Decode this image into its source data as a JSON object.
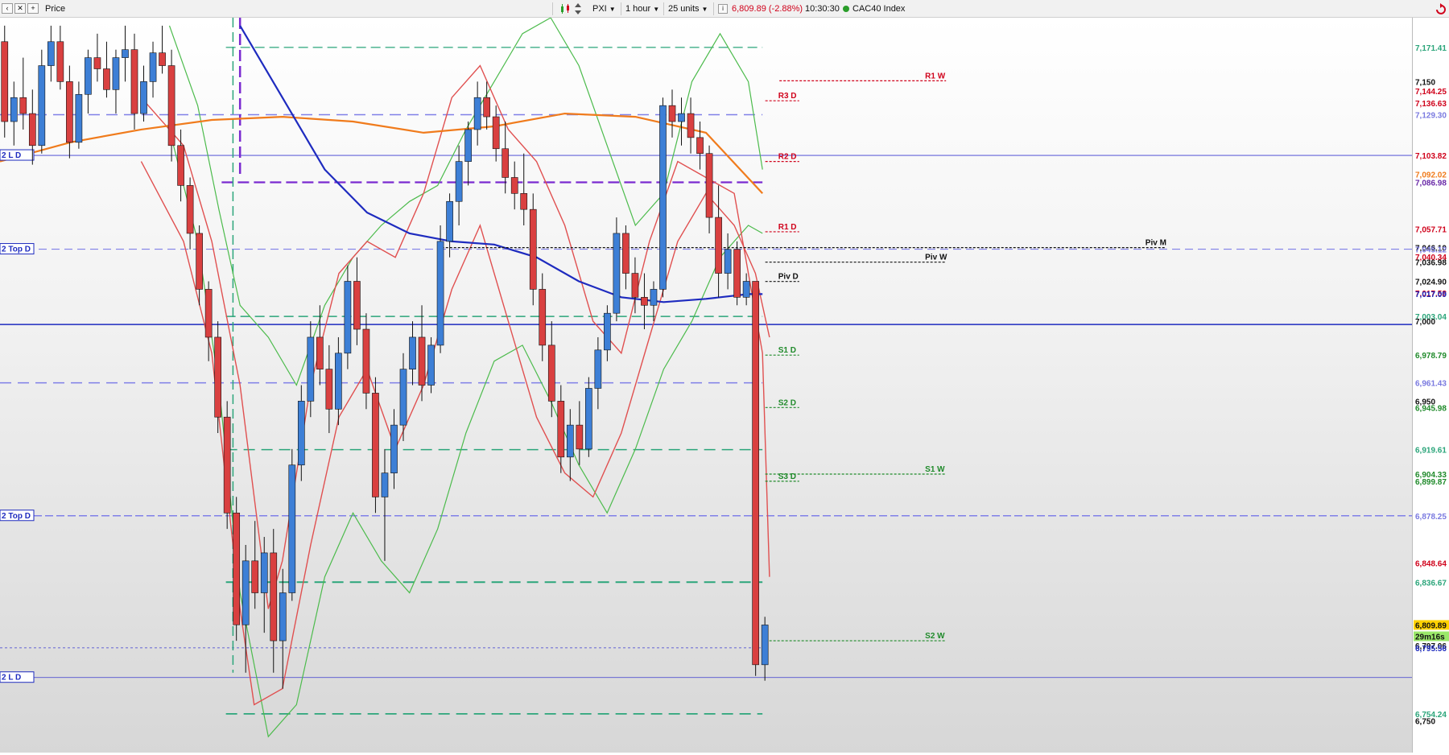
{
  "toolbar": {
    "price_label": "Price",
    "ticker": "PXI",
    "interval": "1 hour",
    "units": "25 units",
    "info_icon": "i",
    "last": "6,809.89 (-2.88%)",
    "time": "10:30:30",
    "index_name": "CAC40 Index",
    "colors": {
      "down": "#d0021b",
      "status": "#2a9d2a"
    }
  },
  "chart_data": {
    "type": "candlestick",
    "title": "",
    "ylim": [
      6730,
      7190
    ],
    "axis_ticks": [
      {
        "label": "7,171.41",
        "value": 7171.41,
        "color": "#2ba57a"
      },
      {
        "label": "7,150",
        "value": 7150,
        "color": "#111111"
      },
      {
        "label": "7,144.25",
        "value": 7144.25,
        "color": "#d0021b"
      },
      {
        "label": "7,136.63",
        "value": 7136.63,
        "color": "#d0021b"
      },
      {
        "label": "7,129.30",
        "value": 7129.3,
        "color": "#7a7ae0"
      },
      {
        "label": "7,103.82",
        "value": 7103.82,
        "color": "#d0021b"
      },
      {
        "label": "7,092.02",
        "value": 7092.02,
        "color": "#f07b1c"
      },
      {
        "label": "7,086.98",
        "value": 7086.98,
        "color": "#6a2aa8"
      },
      {
        "label": "7,057.71",
        "value": 7057.71,
        "color": "#d0021b"
      },
      {
        "label": "7,046.10",
        "value": 7046.1,
        "color": "#111111"
      },
      {
        "label": "7,045.12",
        "value": 7045.12,
        "color": "#7a7ae0"
      },
      {
        "label": "7,040.34",
        "value": 7040.34,
        "color": "#d0021b"
      },
      {
        "label": "7,036.98",
        "value": 7036.98,
        "color": "#111111"
      },
      {
        "label": "7,024.90",
        "value": 7024.9,
        "color": "#111111"
      },
      {
        "label": "7,017.58",
        "value": 7017.58,
        "color": "#d0021b"
      },
      {
        "label": "7,017.09",
        "value": 7017.09,
        "color": "#1e2bbf"
      },
      {
        "label": "7,003.04",
        "value": 7003.04,
        "color": "#2ba57a"
      },
      {
        "label": "7,000",
        "value": 7000,
        "color": "#111111"
      },
      {
        "label": "6,978.79",
        "value": 6978.79,
        "color": "#1f8a2a"
      },
      {
        "label": "6,961.43",
        "value": 6961.43,
        "color": "#7a7ae0"
      },
      {
        "label": "6,950",
        "value": 6950,
        "color": "#111111"
      },
      {
        "label": "6,945.98",
        "value": 6945.98,
        "color": "#1f8a2a"
      },
      {
        "label": "6,919.61",
        "value": 6919.61,
        "color": "#2ba57a"
      },
      {
        "label": "6,904.33",
        "value": 6904.33,
        "color": "#1f8a2a"
      },
      {
        "label": "6,899.87",
        "value": 6899.87,
        "color": "#1f8a2a"
      },
      {
        "label": "6,878.25",
        "value": 6878.25,
        "color": "#7a7ae0"
      },
      {
        "label": "6,848.64",
        "value": 6848.64,
        "color": "#d0021b"
      },
      {
        "label": "6,836.67",
        "value": 6836.67,
        "color": "#2ba57a"
      },
      {
        "label": "6,809.89",
        "value": 6809.89,
        "color": "#111111",
        "bg": "#ffd200"
      },
      {
        "label": "29m16s",
        "value": 6802.8,
        "color": "#111111",
        "bg": "#9be86a"
      },
      {
        "label": "6,797.06",
        "value": 6797.06,
        "color": "#111111"
      },
      {
        "label": "6,795.56",
        "value": 6795.56,
        "color": "#1e2bbf"
      },
      {
        "label": "6,754.24",
        "value": 6754.24,
        "color": "#2ba57a"
      },
      {
        "label": "6,750",
        "value": 6750,
        "color": "#111111"
      }
    ],
    "pivot_labels": [
      {
        "label": "R1 W",
        "value": 7150.5,
        "color": "#d0021b",
        "x1": 0.552,
        "x2": 0.67
      },
      {
        "label": "R3 D",
        "value": 7138.0,
        "color": "#d0021b",
        "x1": 0.542,
        "x2": 0.566
      },
      {
        "label": "R2 D",
        "value": 7100.0,
        "color": "#d0021b",
        "x1": 0.542,
        "x2": 0.566
      },
      {
        "label": "R1 D",
        "value": 7056.0,
        "color": "#d0021b",
        "x1": 0.542,
        "x2": 0.566
      },
      {
        "label": "Piv M",
        "value": 7046.1,
        "color": "#111111",
        "x1": 0.31,
        "x2": 0.826
      },
      {
        "label": "Piv W",
        "value": 7036.98,
        "color": "#111111",
        "x1": 0.542,
        "x2": 0.67
      },
      {
        "label": "Piv D",
        "value": 7024.9,
        "color": "#111111",
        "x1": 0.542,
        "x2": 0.566
      },
      {
        "label": "S1 D",
        "value": 6978.79,
        "color": "#1f8a2a",
        "x1": 0.542,
        "x2": 0.566
      },
      {
        "label": "S2 D",
        "value": 6945.98,
        "color": "#1f8a2a",
        "x1": 0.542,
        "x2": 0.566
      },
      {
        "label": "S1 W",
        "value": 6904.33,
        "color": "#1f8a2a",
        "x1": 0.542,
        "x2": 0.67
      },
      {
        "label": "S3 D",
        "value": 6899.87,
        "color": "#1f8a2a",
        "x1": 0.542,
        "x2": 0.566
      },
      {
        "label": "S2 W",
        "value": 6800.0,
        "color": "#1f8a2a",
        "x1": 0.542,
        "x2": 0.67
      }
    ],
    "left_labels": [
      {
        "label": "2 L D",
        "value": 7103.82
      },
      {
        "label": "2 Top D",
        "value": 7045.12
      },
      {
        "label": "2 Top D",
        "value": 6878.25
      },
      {
        "label": "2 L D",
        "value": 6777.0
      }
    ],
    "horizontal_lines": [
      {
        "value": 7171.41,
        "color": "#2ba57a",
        "dash": "12,6",
        "x1": 0.16,
        "x2": 0.54,
        "w": 1.2
      },
      {
        "value": 7129.3,
        "color": "#8080e8",
        "dash": "14,8",
        "x1": 0.0,
        "x2": 0.54,
        "w": 1.5
      },
      {
        "value": 7103.82,
        "color": "#3a3ad0",
        "dash": "",
        "x1": 0.0,
        "x2": 1.0,
        "w": 0.8
      },
      {
        "value": 7086.98,
        "color": "#7a2ad0",
        "dash": "14,6",
        "x1": 0.157,
        "x2": 0.54,
        "w": 2.2
      },
      {
        "value": 7045.12,
        "color": "#8080e8",
        "dash": "10,6",
        "x1": 0.0,
        "x2": 1.0,
        "w": 1.2
      },
      {
        "value": 7003.04,
        "color": "#2ba57a",
        "dash": "12,6",
        "x1": 0.16,
        "x2": 0.54,
        "w": 1.5
      },
      {
        "value": 6998.0,
        "color": "#1e2bbf",
        "dash": "",
        "x1": 0.0,
        "x2": 1.0,
        "w": 1.5
      },
      {
        "value": 6961.43,
        "color": "#8080e8",
        "dash": "14,8",
        "x1": 0.0,
        "x2": 0.54,
        "w": 1.5
      },
      {
        "value": 6919.61,
        "color": "#2ba57a",
        "dash": "14,8",
        "x1": 0.16,
        "x2": 0.54,
        "w": 1.5
      },
      {
        "value": 6878.25,
        "color": "#8080e8",
        "dash": "10,4",
        "x1": 0.0,
        "x2": 1.0,
        "w": 1.5
      },
      {
        "value": 6836.67,
        "color": "#2ba57a",
        "dash": "14,8",
        "x1": 0.16,
        "x2": 0.54,
        "w": 2.0
      },
      {
        "value": 6795.56,
        "color": "#3a3ad0",
        "dash": "3,3",
        "x1": 0.0,
        "x2": 0.54,
        "w": 0.8
      },
      {
        "value": 6777.0,
        "color": "#3a3ad0",
        "dash": "",
        "x1": 0.0,
        "x2": 1.0,
        "w": 0.8
      },
      {
        "value": 6754.24,
        "color": "#2ba57a",
        "dash": "14,8",
        "x1": 0.16,
        "x2": 0.54,
        "w": 1.8
      }
    ],
    "ohlc": [
      [
        7175,
        7185,
        7115,
        7125
      ],
      [
        7125,
        7150,
        7110,
        7140
      ],
      [
        7140,
        7165,
        7120,
        7130
      ],
      [
        7130,
        7145,
        7098,
        7110
      ],
      [
        7110,
        7170,
        7105,
        7160
      ],
      [
        7160,
        7185,
        7150,
        7175
      ],
      [
        7175,
        7185,
        7145,
        7150
      ],
      [
        7150,
        7160,
        7102,
        7112
      ],
      [
        7112,
        7150,
        7108,
        7142
      ],
      [
        7142,
        7170,
        7130,
        7165
      ],
      [
        7165,
        7180,
        7150,
        7158
      ],
      [
        7158,
        7175,
        7140,
        7145
      ],
      [
        7145,
        7170,
        7130,
        7165
      ],
      [
        7165,
        7185,
        7150,
        7170
      ],
      [
        7170,
        7180,
        7120,
        7130
      ],
      [
        7130,
        7160,
        7125,
        7150
      ],
      [
        7150,
        7175,
        7140,
        7168
      ],
      [
        7168,
        7185,
        7155,
        7160
      ],
      [
        7160,
        7170,
        7100,
        7110
      ],
      [
        7110,
        7120,
        7075,
        7085
      ],
      [
        7085,
        7090,
        7045,
        7055
      ],
      [
        7055,
        7060,
        7010,
        7020
      ],
      [
        7020,
        7025,
        6975,
        6990
      ],
      [
        6990,
        7000,
        6930,
        6940
      ],
      [
        6940,
        6950,
        6870,
        6880
      ],
      [
        6880,
        6890,
        6800,
        6810
      ],
      [
        6810,
        6860,
        6780,
        6850
      ],
      [
        6850,
        6875,
        6820,
        6830
      ],
      [
        6830,
        6865,
        6805,
        6855
      ],
      [
        6855,
        6870,
        6780,
        6800
      ],
      [
        6800,
        6845,
        6770,
        6830
      ],
      [
        6830,
        6920,
        6825,
        6910
      ],
      [
        6910,
        6960,
        6900,
        6950
      ],
      [
        6950,
        7000,
        6940,
        6990
      ],
      [
        6990,
        7010,
        6960,
        6970
      ],
      [
        6970,
        6985,
        6930,
        6945
      ],
      [
        6945,
        6990,
        6935,
        6980
      ],
      [
        6980,
        7035,
        6970,
        7025
      ],
      [
        7025,
        7040,
        6985,
        6995
      ],
      [
        6995,
        7005,
        6945,
        6955
      ],
      [
        6955,
        6965,
        6880,
        6890
      ],
      [
        6890,
        6920,
        6850,
        6905
      ],
      [
        6905,
        6945,
        6895,
        6935
      ],
      [
        6935,
        6980,
        6925,
        6970
      ],
      [
        6970,
        7000,
        6960,
        6990
      ],
      [
        6990,
        7010,
        6950,
        6960
      ],
      [
        6960,
        6990,
        6955,
        6985
      ],
      [
        6985,
        7060,
        6980,
        7050
      ],
      [
        7050,
        7080,
        7040,
        7075
      ],
      [
        7075,
        7110,
        7060,
        7100
      ],
      [
        7100,
        7125,
        7085,
        7120
      ],
      [
        7120,
        7150,
        7110,
        7140
      ],
      [
        7140,
        7150,
        7120,
        7128
      ],
      [
        7128,
        7135,
        7100,
        7108
      ],
      [
        7108,
        7125,
        7080,
        7090
      ],
      [
        7090,
        7100,
        7070,
        7080
      ],
      [
        7080,
        7105,
        7060,
        7070
      ],
      [
        7070,
        7080,
        7010,
        7020
      ],
      [
        7020,
        7030,
        6975,
        6985
      ],
      [
        6985,
        7000,
        6940,
        6950
      ],
      [
        6950,
        6960,
        6905,
        6915
      ],
      [
        6915,
        6945,
        6900,
        6935
      ],
      [
        6935,
        6950,
        6910,
        6920
      ],
      [
        6920,
        6965,
        6915,
        6958
      ],
      [
        6958,
        6990,
        6945,
        6982
      ],
      [
        6982,
        7010,
        6975,
        7005
      ],
      [
        7005,
        7065,
        7000,
        7055
      ],
      [
        7055,
        7060,
        7020,
        7030
      ],
      [
        7030,
        7040,
        7005,
        7015
      ],
      [
        7015,
        7030,
        6995,
        7010
      ],
      [
        7010,
        7025,
        7000,
        7020
      ],
      [
        7020,
        7140,
        7015,
        7135
      ],
      [
        7135,
        7145,
        7115,
        7125
      ],
      [
        7125,
        7140,
        7110,
        7130
      ],
      [
        7130,
        7140,
        7105,
        7115
      ],
      [
        7115,
        7125,
        7095,
        7105
      ],
      [
        7105,
        7110,
        7055,
        7065
      ],
      [
        7065,
        7085,
        7015,
        7030
      ],
      [
        7030,
        7055,
        7020,
        7045
      ],
      [
        7045,
        7050,
        7010,
        7015
      ],
      [
        7015,
        7030,
        7010,
        7025
      ],
      [
        7025,
        7025,
        6778,
        6785
      ],
      [
        6785,
        6815,
        6775,
        6809.89
      ]
    ],
    "ma_orange": [
      [
        0.0,
        7100
      ],
      [
        0.05,
        7112
      ],
      [
        0.1,
        7120
      ],
      [
        0.15,
        7126
      ],
      [
        0.2,
        7128
      ],
      [
        0.25,
        7125
      ],
      [
        0.3,
        7118
      ],
      [
        0.35,
        7122
      ],
      [
        0.4,
        7130
      ],
      [
        0.45,
        7128
      ],
      [
        0.5,
        7118
      ],
      [
        0.54,
        7080
      ]
    ],
    "ma_blue": [
      [
        0.17,
        7185
      ],
      [
        0.2,
        7140
      ],
      [
        0.23,
        7095
      ],
      [
        0.26,
        7068
      ],
      [
        0.29,
        7055
      ],
      [
        0.32,
        7050
      ],
      [
        0.35,
        7048
      ],
      [
        0.38,
        7040
      ],
      [
        0.41,
        7025
      ],
      [
        0.44,
        7015
      ],
      [
        0.47,
        7012
      ],
      [
        0.5,
        7014
      ],
      [
        0.53,
        7017
      ],
      [
        0.54,
        7017
      ]
    ],
    "bb_upper": [
      [
        0.12,
        7185
      ],
      [
        0.14,
        7135
      ],
      [
        0.155,
        7070
      ],
      [
        0.17,
        7010
      ],
      [
        0.19,
        6990
      ],
      [
        0.21,
        6960
      ],
      [
        0.23,
        7010
      ],
      [
        0.25,
        7040
      ],
      [
        0.27,
        7060
      ],
      [
        0.29,
        7075
      ],
      [
        0.31,
        7085
      ],
      [
        0.33,
        7120
      ],
      [
        0.35,
        7150
      ],
      [
        0.37,
        7180
      ],
      [
        0.39,
        7190
      ],
      [
        0.41,
        7160
      ],
      [
        0.43,
        7110
      ],
      [
        0.45,
        7060
      ],
      [
        0.47,
        7080
      ],
      [
        0.49,
        7150
      ],
      [
        0.51,
        7180
      ],
      [
        0.53,
        7150
      ],
      [
        0.54,
        7095
      ]
    ],
    "bb_lower": [
      [
        0.12,
        7120
      ],
      [
        0.14,
        7050
      ],
      [
        0.155,
        6960
      ],
      [
        0.17,
        6830
      ],
      [
        0.19,
        6740
      ],
      [
        0.21,
        6760
      ],
      [
        0.23,
        6840
      ],
      [
        0.25,
        6880
      ],
      [
        0.27,
        6850
      ],
      [
        0.29,
        6830
      ],
      [
        0.31,
        6870
      ],
      [
        0.33,
        6930
      ],
      [
        0.35,
        6975
      ],
      [
        0.37,
        6985
      ],
      [
        0.39,
        6950
      ],
      [
        0.41,
        6910
      ],
      [
        0.43,
        6880
      ],
      [
        0.45,
        6920
      ],
      [
        0.47,
        6970
      ],
      [
        0.49,
        7000
      ],
      [
        0.51,
        7040
      ],
      [
        0.53,
        7060
      ],
      [
        0.54,
        7055
      ]
    ],
    "red_upper": [
      [
        0.1,
        7140
      ],
      [
        0.13,
        7110
      ],
      [
        0.15,
        7050
      ],
      [
        0.17,
        6960
      ],
      [
        0.19,
        6820
      ],
      [
        0.2,
        6850
      ],
      [
        0.22,
        6960
      ],
      [
        0.24,
        7030
      ],
      [
        0.26,
        7050
      ],
      [
        0.28,
        7040
      ],
      [
        0.3,
        7080
      ],
      [
        0.32,
        7140
      ],
      [
        0.34,
        7160
      ],
      [
        0.36,
        7120
      ],
      [
        0.38,
        7100
      ],
      [
        0.4,
        7060
      ],
      [
        0.42,
        7000
      ],
      [
        0.44,
        6980
      ],
      [
        0.46,
        7050
      ],
      [
        0.48,
        7100
      ],
      [
        0.5,
        7090
      ],
      [
        0.52,
        7080
      ],
      [
        0.54,
        6980
      ],
      [
        0.545,
        6840
      ]
    ],
    "red_lower": [
      [
        0.1,
        7100
      ],
      [
        0.13,
        7050
      ],
      [
        0.15,
        6980
      ],
      [
        0.17,
        6820
      ],
      [
        0.18,
        6760
      ],
      [
        0.2,
        6770
      ],
      [
        0.22,
        6860
      ],
      [
        0.24,
        6940
      ],
      [
        0.26,
        6970
      ],
      [
        0.28,
        6920
      ],
      [
        0.3,
        6960
      ],
      [
        0.32,
        7020
      ],
      [
        0.34,
        7060
      ],
      [
        0.36,
        7000
      ],
      [
        0.38,
        6940
      ],
      [
        0.4,
        6905
      ],
      [
        0.42,
        6890
      ],
      [
        0.44,
        6930
      ],
      [
        0.46,
        6990
      ],
      [
        0.48,
        7050
      ],
      [
        0.5,
        7080
      ],
      [
        0.52,
        7060
      ],
      [
        0.535,
        7030
      ],
      [
        0.545,
        6990
      ]
    ]
  }
}
